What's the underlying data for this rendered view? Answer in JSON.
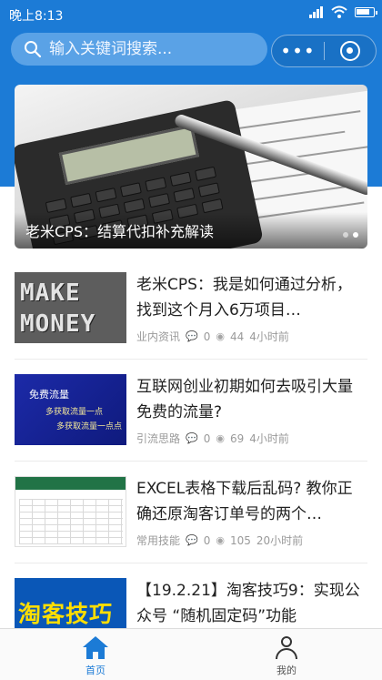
{
  "status_bar": {
    "time": "晚上8:13",
    "battery_level": 0.8
  },
  "search": {
    "placeholder": "输入关键词搜索..."
  },
  "capsule": {
    "more_label": "•••"
  },
  "banner": {
    "caption": "老米CPS：结算代扣补充解读",
    "slide_count": 2,
    "active_slide": 1
  },
  "articles": [
    {
      "title": "老米CPS：我是如何通过分析，找到这个月入6万项目…",
      "category": "业内资讯",
      "comments": "0",
      "views": "44",
      "time": "4小时前",
      "thumb_text": [
        "MAKE",
        "MONEY"
      ]
    },
    {
      "title": "互联网创业初期如何去吸引大量免费的流量?",
      "category": "引流思路",
      "comments": "0",
      "views": "69",
      "time": "4小时前",
      "thumb_text": [
        "免费流量",
        "多获取流量一点",
        "多获取流量一点点"
      ]
    },
    {
      "title": "EXCEL表格下载后乱码? 教你正确还原淘客订单号的两个…",
      "category": "常用技能",
      "comments": "0",
      "views": "105",
      "time": "20小时前"
    },
    {
      "title": "【19.2.21】淘客技巧9：实现公众号 “随机固定码”功能",
      "thumb_text": "淘客技巧"
    }
  ],
  "tabbar": {
    "home": "首页",
    "mine": "我的",
    "active_color": "#1c7bd6"
  },
  "colors": {
    "brand": "#1c7bd6"
  }
}
